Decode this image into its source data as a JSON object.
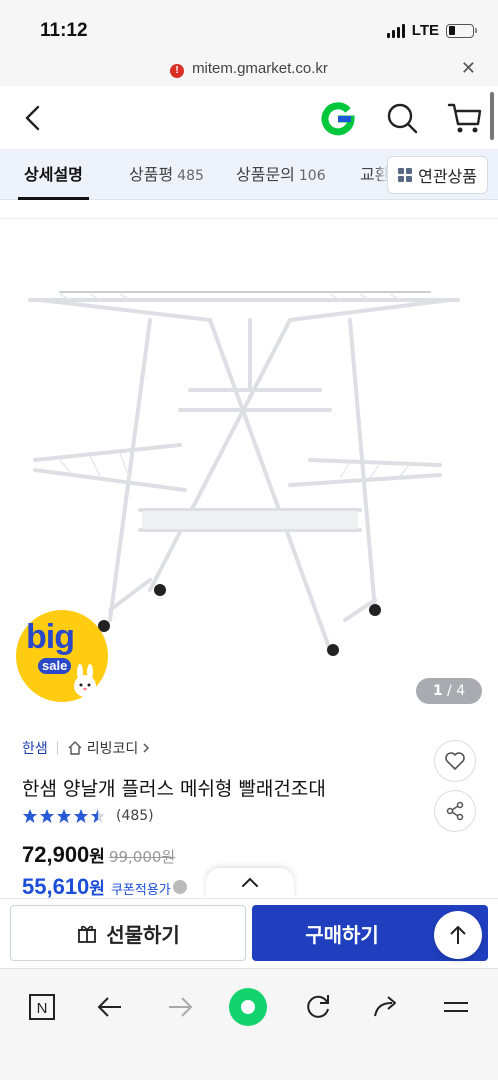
{
  "status_bar": {
    "time": "11:12",
    "network": "LTE",
    "icons": [
      "signal-icon",
      "battery-icon"
    ]
  },
  "url_bar": {
    "url": "mitem.gmarket.co.kr",
    "security_icon": "warning-icon",
    "close_icon": "close-icon"
  },
  "header": {
    "icons": [
      "back-icon",
      "gmarket-logo",
      "search-icon",
      "cart-icon"
    ],
    "logo_text": "G",
    "colors": {
      "logo_green": "#00c73c",
      "logo_blue": "#1c55d8"
    }
  },
  "tabs": {
    "items": [
      {
        "label": "상세설명",
        "count": ""
      },
      {
        "label": "상품평",
        "count": "485"
      },
      {
        "label": "상품문의",
        "count": "106"
      },
      {
        "label": "교환",
        "count": ""
      }
    ],
    "related": "연관상품"
  },
  "gallery": {
    "current": "1",
    "total": "4",
    "separator": "/",
    "badge_big": "big",
    "badge_sale": "sale"
  },
  "product": {
    "brand": "한샘",
    "category": "리빙코디",
    "title": "한샘 양날개 플러스 메쉬형 빨래건조대",
    "rating": 4.5,
    "rating_max": 5,
    "review_count": "(485)",
    "price": "72,900",
    "price_unit": "원",
    "original_price": "99,000원",
    "coupon_price": "55,610",
    "coupon_unit": "원",
    "coupon_label": "쿠폰적용가"
  },
  "actions": {
    "gift": "선물하기",
    "buy": "구매하기"
  },
  "colors": {
    "accent": "#1f3fbf",
    "coupon": "#1c4ed8",
    "brand_link": "#1c3fb4",
    "star": "#2a5bd7",
    "badge": "#ffcc12"
  },
  "toolbar": {
    "icons": [
      "naver-home-icon",
      "back-arrow-icon",
      "forward-arrow-icon",
      "green-dot-icon",
      "refresh-icon",
      "share-icon",
      "menu-icon"
    ],
    "home_letter": "N"
  }
}
